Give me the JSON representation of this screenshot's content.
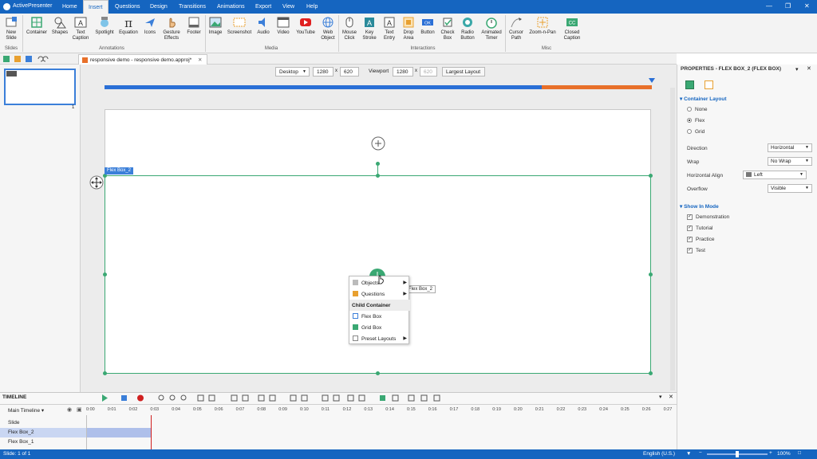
{
  "app": {
    "name": "ActivePresenter"
  },
  "menu": [
    "Home",
    "Insert",
    "Questions",
    "Design",
    "Transitions",
    "Animations",
    "Export",
    "View",
    "Help"
  ],
  "menu_active": "Insert",
  "ribbon": {
    "slides": {
      "new_slide": "New Slide",
      "label": "Slides"
    },
    "annotations": {
      "label": "Annotations",
      "items": [
        "Container",
        "Shapes",
        "Text Caption",
        "Spotlight",
        "Equation",
        "Icons",
        "Gesture Effects",
        "Footer"
      ]
    },
    "media": {
      "label": "Media",
      "items": [
        "Image",
        "Screenshot",
        "Audio",
        "Video",
        "YouTube",
        "Web Object"
      ]
    },
    "interactions": {
      "label": "Interactions",
      "items": [
        "Mouse Click",
        "Key Stroke",
        "Text Entry",
        "Drop Area",
        "Button",
        "Check Box",
        "Radio Button",
        "Animated Timer"
      ]
    },
    "misc": {
      "label": "Misc",
      "items": [
        "Cursor Path",
        "Zoom-n-Pan",
        "Closed Caption"
      ]
    }
  },
  "document": {
    "tab_title": "responsive demo - responsive demo.approj*"
  },
  "slides_panel": {
    "thumb_number": "1"
  },
  "canvas_toolbar": {
    "layout": "Desktop",
    "width": "1280",
    "height": "620",
    "viewport_label": "Viewport",
    "viewport_width": "1280",
    "viewport_height": "620",
    "largest_layout": "Largest Layout"
  },
  "flexbox_label": "Flex Box_2",
  "tooltip": "Flex Box_2",
  "context_menu": {
    "objects": "Objects",
    "questions": "Questions",
    "child_container": "Child Container",
    "flex_box": "Flex Box",
    "grid_box": "Grid Box",
    "preset_layouts": "Preset Layouts"
  },
  "properties": {
    "title": "PROPERTIES - FLEX BOX_2 (FLEX BOX)",
    "container_layout": "Container Layout",
    "layout_options": [
      "None",
      "Flex",
      "Grid"
    ],
    "selected_layout": "Flex",
    "direction_label": "Direction",
    "direction_value": "Horizontal",
    "wrap_label": "Wrap",
    "wrap_value": "No Wrap",
    "halign_label": "Horizontal Align",
    "halign_value": "Left",
    "overflow_label": "Overflow",
    "overflow_value": "Visible",
    "show_in_mode": "Show In Mode",
    "modes": [
      "Demonstration",
      "Tutorial",
      "Practice",
      "Test"
    ]
  },
  "timeline": {
    "title": "TIMELINE",
    "main_timeline": "Main Timeline",
    "rows": [
      "Slide",
      "Flex Box_2",
      "Flex Box_1"
    ],
    "ticks": [
      "0:00",
      "0:01",
      "0:02",
      "0:03",
      "0:04",
      "0:05",
      "0:06",
      "0:07",
      "0:08",
      "0:09",
      "0:10",
      "0:11",
      "0:12",
      "0:13",
      "0:14",
      "0:15",
      "0:16",
      "0:17",
      "0:18",
      "0:19",
      "0:20",
      "0:21",
      "0:22",
      "0:23",
      "0:24",
      "0:25",
      "0:26",
      "0:27"
    ]
  },
  "status": {
    "slide": "Slide: 1 of 1",
    "language": "English (U.S.)",
    "zoom": "100%"
  },
  "colors": {
    "accent": "#1565c0",
    "selection": "#3aa873",
    "ruler": "#2a6fd6",
    "ruler_end": "#e8702a"
  }
}
